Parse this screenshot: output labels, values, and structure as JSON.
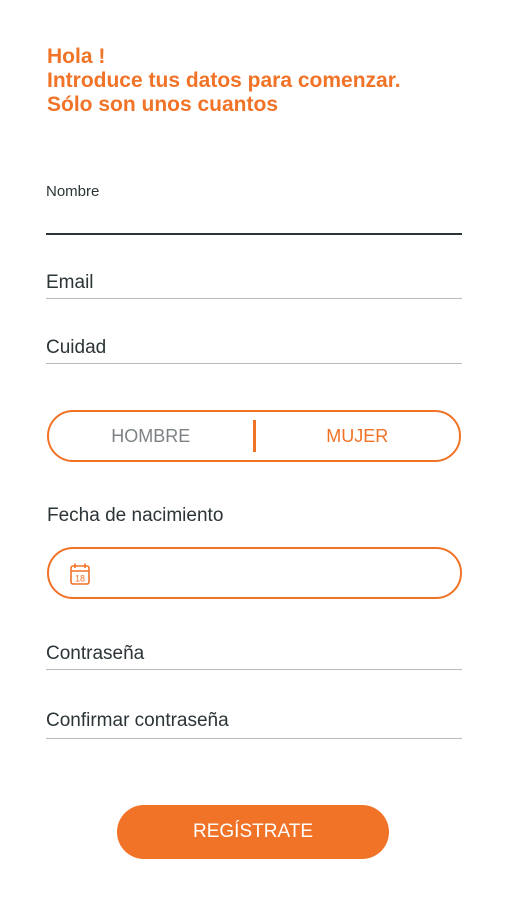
{
  "header": {
    "line1": "Hola !",
    "line2": "Introduce tus datos para comenzar.",
    "line3": "Sólo son unos cuantos"
  },
  "fields": {
    "nombre": "Nombre",
    "email": "Email",
    "ciudad": "Cuidad",
    "fecha_label": "Fecha de nacimiento",
    "contrasena": "Contraseña",
    "confirmar": "Confirmar contraseña"
  },
  "gender": {
    "options": [
      "HOMBRE",
      "MUJER"
    ],
    "selected": "MUJER"
  },
  "date": {
    "icon": "calendar-icon",
    "icon_day": "18"
  },
  "submit_label": "REGÍSTRATE",
  "colors": {
    "accent": "#f07327",
    "text": "#2b3437",
    "muted": "#7c8285",
    "line": "#b9bdc0"
  }
}
